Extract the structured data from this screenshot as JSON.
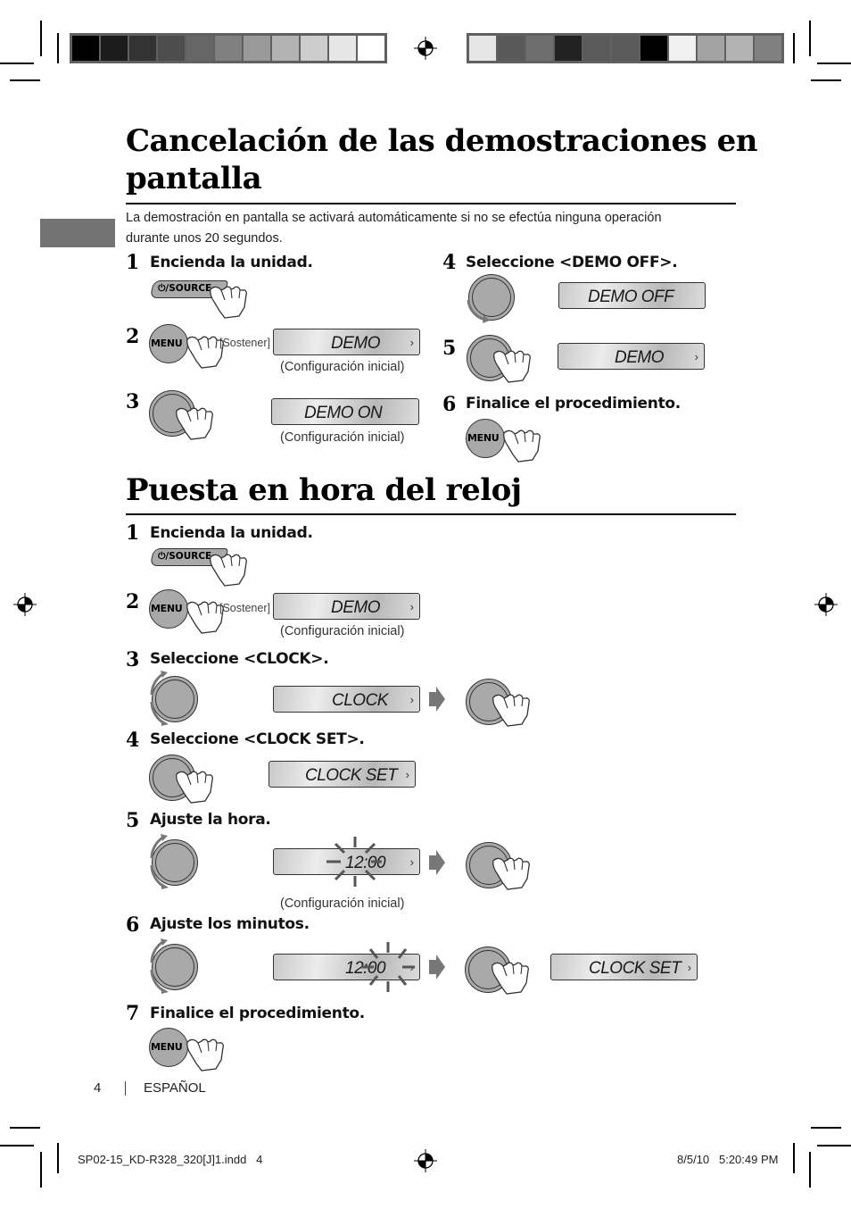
{
  "colors": {
    "left_bar": [
      "#000000",
      "#1c1c1c",
      "#333333",
      "#4d4d4d",
      "#666666",
      "#808080",
      "#999999",
      "#b3b3b3",
      "#cccccc",
      "#e6e6e6",
      "#ffffff"
    ],
    "right_bar": [
      "#e6e6e6",
      "#595959",
      "#6e6e6e",
      "#222222",
      "#5a5a5a",
      "#5a5a5a",
      "#000000",
      "#f0f0f0",
      "#a3a3a3",
      "#b3b3b3",
      "#808080"
    ],
    "lang_tab": "#737373",
    "button_gray": "#a9a9a9"
  },
  "section1": {
    "title_line1": "Cancelación de las demostraciones en",
    "title_line2": "pantalla",
    "intro_line1": "La demostración en pantalla se activará automáticamente si no se efectúa ninguna operación",
    "intro_line2": "durante unos 20 segundos.",
    "steps": [
      {
        "num": "1",
        "text": "Encienda la unidad.",
        "button": "⏻/SOURCE"
      },
      {
        "num": "2",
        "button": "MENU",
        "hold": "[Sostener]",
        "display": "DEMO",
        "caption": "(Configuración inicial)"
      },
      {
        "num": "3",
        "display": "DEMO ON",
        "caption": "(Configuración inicial)"
      },
      {
        "num": "4",
        "text": "Seleccione <DEMO OFF>.",
        "display": "DEMO OFF"
      },
      {
        "num": "5",
        "display": "DEMO"
      },
      {
        "num": "6",
        "text": "Finalice el procedimiento.",
        "button": "MENU"
      }
    ]
  },
  "section2": {
    "title": "Puesta en hora del reloj",
    "steps": [
      {
        "num": "1",
        "text": "Encienda la unidad.",
        "button": "⏻/SOURCE"
      },
      {
        "num": "2",
        "button": "MENU",
        "hold": "[Sostener]",
        "display": "DEMO",
        "caption": "(Configuración inicial)"
      },
      {
        "num": "3",
        "text": "Seleccione <CLOCK>.",
        "display": "CLOCK"
      },
      {
        "num": "4",
        "text": "Seleccione <CLOCK SET>.",
        "display": "CLOCK SET"
      },
      {
        "num": "5",
        "text": "Ajuste la hora.",
        "display": "12:00",
        "caption": "(Configuración inicial)"
      },
      {
        "num": "6",
        "text": "Ajuste los minutos.",
        "display": "12:00",
        "display2": "CLOCK SET"
      },
      {
        "num": "7",
        "text": "Finalice el procedimiento.",
        "button": "MENU"
      }
    ]
  },
  "footer": {
    "page_number": "4",
    "language": "ESPAÑOL",
    "slug_file": "SP02-15_KD-R328_320[J]1.indd   4",
    "slug_date": "8/5/10   5:20:49 PM"
  },
  "icons": {
    "arrow": "›"
  }
}
